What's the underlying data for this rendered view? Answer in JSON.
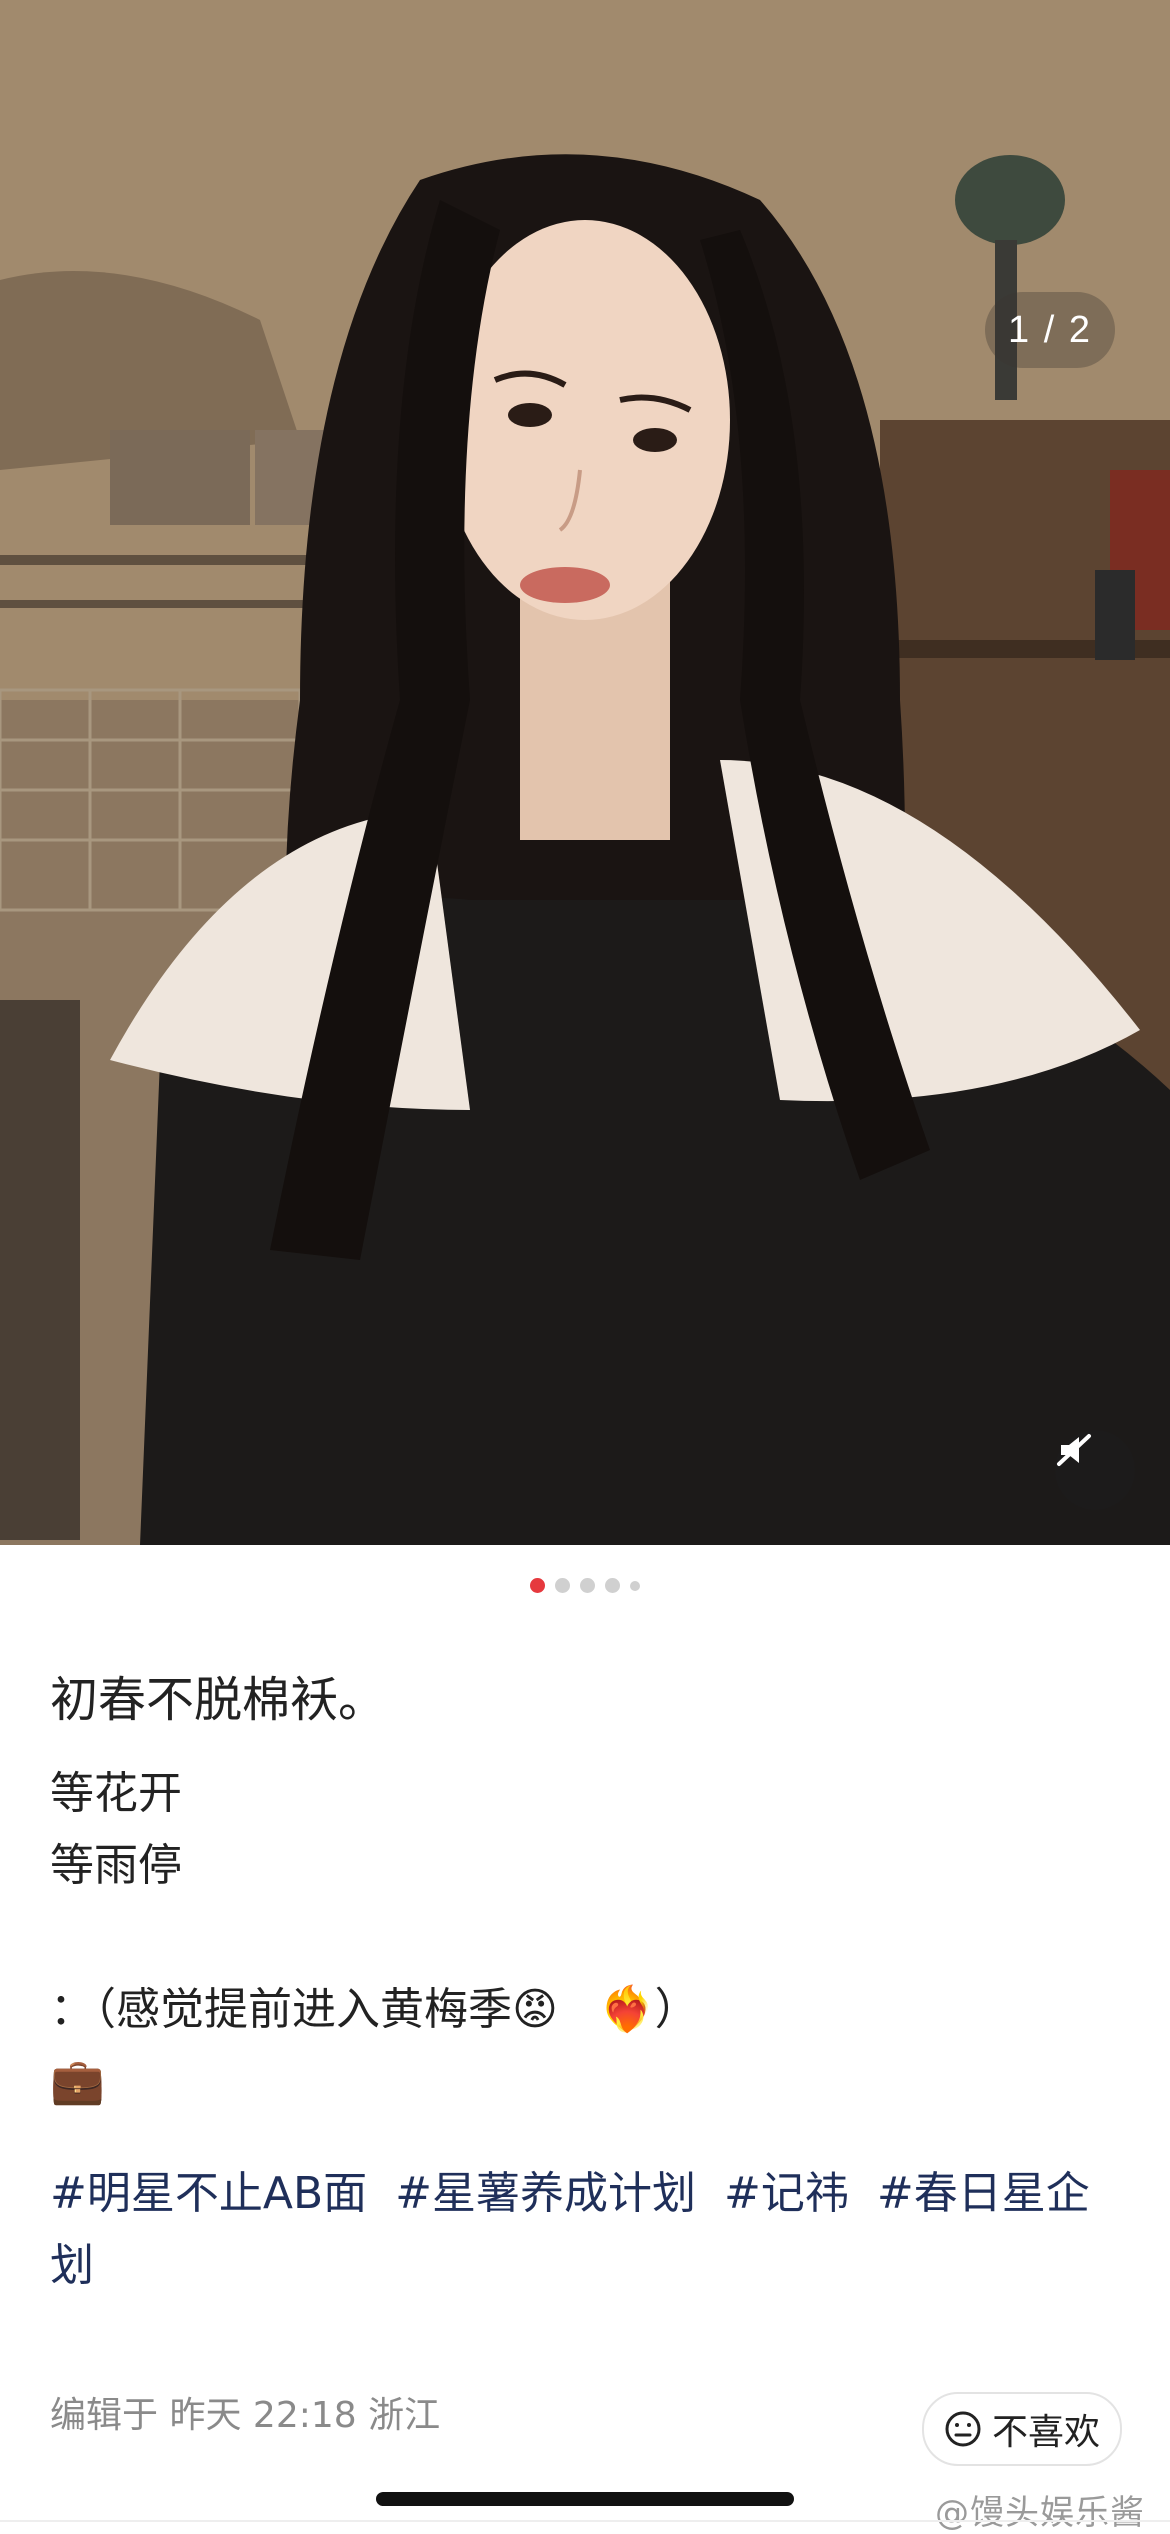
{
  "photo": {
    "counter": "1 / 2",
    "mute_icon": "speaker-muted-icon"
  },
  "carousel": {
    "count": 5,
    "active": 0
  },
  "post": {
    "title": "初春不脱棉袄。",
    "line1": "等花开",
    "line2": "等雨停",
    "line3_text": "：（感觉提前进入黄梅季",
    "emoji_angry": "😡",
    "emoji_heart": "❤️‍🔥",
    "close_paren": "）",
    "emoji_briefcase": "💼",
    "hashtags": [
      "#明星不止AB面",
      "#星薯养成计划",
      "#记祎",
      "#春日星企划"
    ]
  },
  "meta": {
    "edited": "编辑于",
    "time": "昨天 22:18",
    "location": "浙江"
  },
  "dislike": {
    "label": "不喜欢",
    "icon": "neutral-face-icon"
  },
  "watermark": "@馒头娱乐酱"
}
